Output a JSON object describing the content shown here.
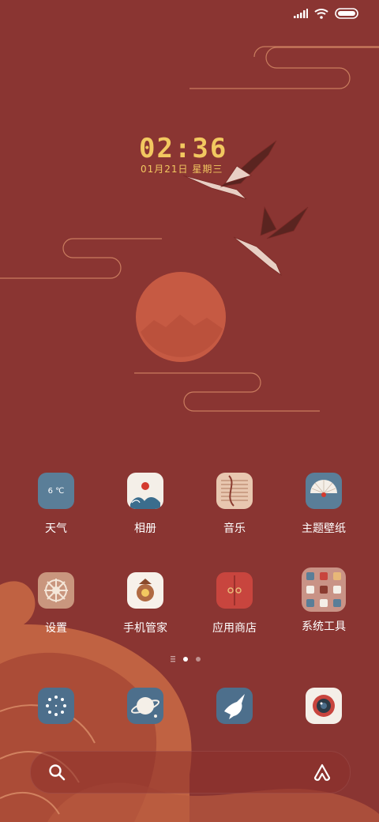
{
  "clock": {
    "time": "02:36",
    "date": "01月21日 星期三"
  },
  "apps_row1": [
    {
      "label": "天气",
      "icon": "weather-icon",
      "value": "6 ℃"
    },
    {
      "label": "相册",
      "icon": "gallery-icon"
    },
    {
      "label": "音乐",
      "icon": "music-icon"
    },
    {
      "label": "主题壁纸",
      "icon": "themes-icon"
    }
  ],
  "apps_row2": [
    {
      "label": "设置",
      "icon": "settings-icon"
    },
    {
      "label": "手机管家",
      "icon": "security-icon"
    },
    {
      "label": "应用商店",
      "icon": "app-store-icon"
    },
    {
      "label": "系统工具",
      "icon": "tools-folder-icon"
    }
  ],
  "dock": [
    {
      "icon": "phone-icon"
    },
    {
      "icon": "browser-icon"
    },
    {
      "icon": "messages-icon"
    },
    {
      "icon": "camera-icon"
    }
  ],
  "colors": {
    "background": "#8a3532",
    "clock": "#f2c860",
    "icon_blue": "#5a7e98"
  }
}
